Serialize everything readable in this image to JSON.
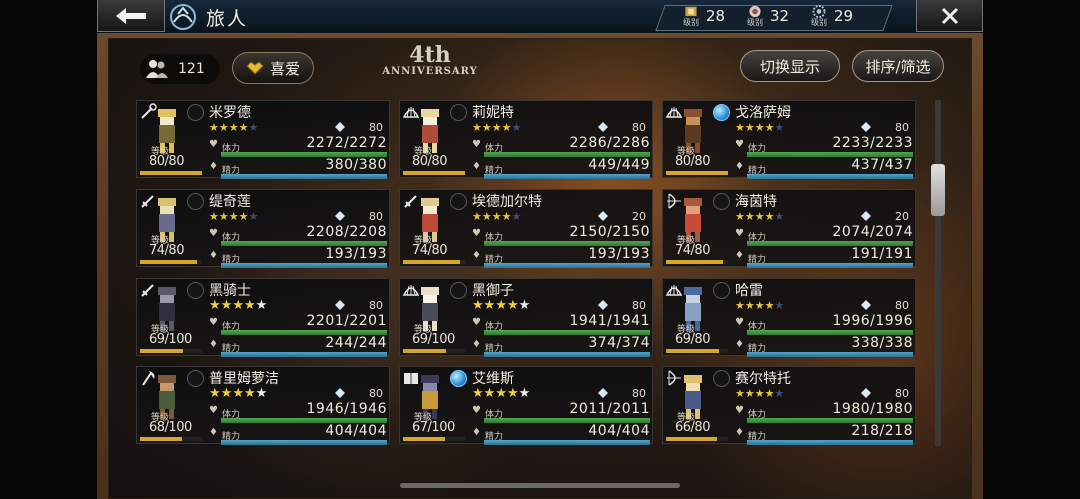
{
  "header": {
    "title": "旅人",
    "ranks": [
      {
        "icon": "warrior-rank-icon",
        "label": "级别",
        "value": "28"
      },
      {
        "icon": "mage-rank-icon",
        "label": "级别",
        "value": "32"
      },
      {
        "icon": "cog-rank-icon",
        "label": "级别",
        "value": "29"
      }
    ]
  },
  "controls": {
    "traveler_count": "121",
    "favorite_label": "喜爱",
    "anniversary_big": "4th",
    "anniversary_small": "ANNIVERSARY",
    "toggle_view_label": "切换显示",
    "sort_filter_label": "排序/筛选"
  },
  "labels": {
    "level": "等级",
    "hp": "体力",
    "sp": "精力"
  },
  "characters": [
    {
      "name": "米罗德",
      "level": "80/80",
      "lvl_fill": 1.0,
      "max_level": "80",
      "hp": "2272/2272",
      "sp": "380/380",
      "stars": "4",
      "weapon": "staff-icon",
      "element": false
    },
    {
      "name": "莉妮特",
      "level": "80/80",
      "lvl_fill": 1.0,
      "max_level": "80",
      "hp": "2286/2286",
      "sp": "449/449",
      "stars": "4",
      "weapon": "fan-icon",
      "element": false
    },
    {
      "name": "戈洛萨姆",
      "level": "80/80",
      "lvl_fill": 1.0,
      "max_level": "80",
      "hp": "2233/2233",
      "sp": "437/437",
      "stars": "4",
      "weapon": "fan-icon",
      "element": true
    },
    {
      "name": "缇奇莲",
      "level": "74/80",
      "lvl_fill": 0.92,
      "max_level": "80",
      "hp": "2208/2208",
      "sp": "193/193",
      "stars": "4",
      "weapon": "sword-icon",
      "element": false
    },
    {
      "name": "埃德加尔特",
      "level": "74/80",
      "lvl_fill": 0.92,
      "max_level": "20",
      "hp": "2150/2150",
      "sp": "193/193",
      "stars": "4",
      "weapon": "sword-icon",
      "element": false
    },
    {
      "name": "海茵特",
      "level": "74/80",
      "lvl_fill": 0.92,
      "max_level": "20",
      "hp": "2074/2074",
      "sp": "191/191",
      "stars": "4",
      "weapon": "bow-icon",
      "element": false
    },
    {
      "name": "黑骑士",
      "level": "69/100",
      "lvl_fill": 0.69,
      "max_level": "80",
      "hp": "2201/2201",
      "sp": "244/244",
      "stars": "5",
      "weapon": "sword-icon",
      "element": false
    },
    {
      "name": "黑御子",
      "level": "69/100",
      "lvl_fill": 0.69,
      "max_level": "80",
      "hp": "1941/1941",
      "sp": "374/374",
      "stars": "5",
      "weapon": "fan-icon",
      "element": false
    },
    {
      "name": "哈雷",
      "level": "69/80",
      "lvl_fill": 0.86,
      "max_level": "80",
      "hp": "1996/1996",
      "sp": "338/338",
      "stars": "4",
      "weapon": "fan-icon",
      "element": false
    },
    {
      "name": "普里姆萝洁",
      "level": "68/100",
      "lvl_fill": 0.68,
      "max_level": "80",
      "hp": "1946/1946",
      "sp": "404/404",
      "stars": "5",
      "weapon": "axe-icon",
      "element": false
    },
    {
      "name": "艾维斯",
      "level": "67/100",
      "lvl_fill": 0.67,
      "max_level": "80",
      "hp": "2011/2011",
      "sp": "404/404",
      "stars": "5",
      "weapon": "book-icon",
      "element": true
    },
    {
      "name": "赛尔特托",
      "level": "66/80",
      "lvl_fill": 0.82,
      "max_level": "80",
      "hp": "1980/1980",
      "sp": "218/218",
      "stars": "4",
      "weapon": "bow-icon",
      "element": false
    }
  ],
  "colors": {
    "hp_bar": "#3f9a44",
    "sp_bar": "#3d8cb4",
    "level_bar": "#d6a628",
    "star": "#e8c53a"
  }
}
